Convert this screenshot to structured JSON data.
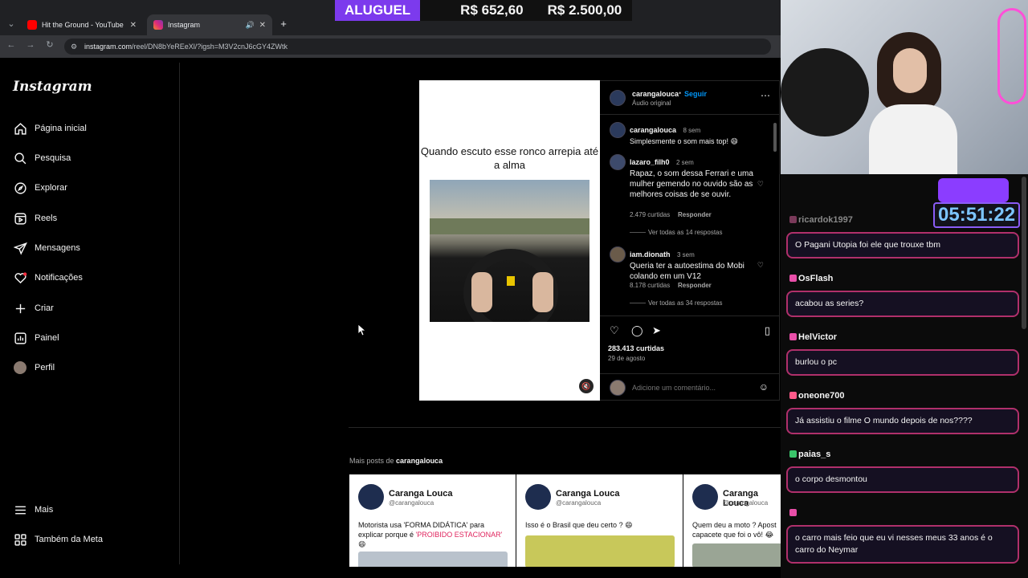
{
  "browser": {
    "tabs": [
      {
        "title": "Hit the Ground - YouTube",
        "active": false
      },
      {
        "title": "Instagram",
        "active": true
      }
    ],
    "url_host": "instagram.com",
    "url_path": "/reel/DN8bYeREeXl/?igsh=M3V2cnJ6cGY4ZWtk"
  },
  "rent_banner": {
    "label": "ALUGUEL",
    "value1": "R$ 652,60",
    "value2": "R$ 2.500,00"
  },
  "instagram": {
    "logo": "Instagram",
    "nav": [
      {
        "label": "Página inicial",
        "icon": "home-icon"
      },
      {
        "label": "Pesquisa",
        "icon": "search-icon"
      },
      {
        "label": "Explorar",
        "icon": "compass-icon"
      },
      {
        "label": "Reels",
        "icon": "reels-icon"
      },
      {
        "label": "Mensagens",
        "icon": "send-icon"
      },
      {
        "label": "Notificações",
        "icon": "heart-icon"
      },
      {
        "label": "Criar",
        "icon": "plus-icon"
      },
      {
        "label": "Painel",
        "icon": "chart-icon"
      },
      {
        "label": "Perfil",
        "icon": "avatar-icon"
      }
    ],
    "bottom_nav": [
      {
        "label": "Mais",
        "icon": "menu-icon"
      },
      {
        "label": "Também da Meta",
        "icon": "meta-icon"
      }
    ],
    "post": {
      "caption": "Quando escuto esse ronco arrepia até a alma",
      "author": "carangalouca",
      "follow": "Seguir",
      "audio": "Áudio original",
      "comments": [
        {
          "user": "carangalouca",
          "time": "8 sem",
          "text": "Simplesmente o som mais top! 😄"
        },
        {
          "user": "lazaro_filh0",
          "time": "2 sem",
          "text": "Rapaz, o som dessa Ferrari e uma mulher gemendo no ouvido são as melhores coisas de se ouvir.",
          "likes": "2.479 curtidas",
          "reply": "Responder",
          "view_replies": "Ver todas as 14 respostas"
        },
        {
          "user": "iam.dionath",
          "time": "3 sem",
          "text": "Queria ter a autoestima do Mobi colando em um V12",
          "likes": "8.178 curtidas",
          "reply": "Responder",
          "view_replies": "Ver todas as 34 respostas"
        }
      ],
      "likes": "283.413 curtidas",
      "date": "29 de agosto",
      "comment_placeholder": "Adicione um comentário..."
    },
    "more_posts": {
      "prefix": "Mais posts de",
      "author": "carangalouca",
      "cards": [
        {
          "name": "Caranga Louca",
          "handle": "@carangalouca",
          "text_a": "Motorista usa 'FORMA DIDÁTICA' para explicar porque é ",
          "text_red": "'PROIBIDO ESTACIONAR'",
          "text_b": " 😄"
        },
        {
          "name": "Caranga Louca",
          "handle": "@carangalouca",
          "text_a": "Isso é o Brasil que deu certo ? 😄",
          "text_red": "",
          "text_b": ""
        },
        {
          "name": "Caranga Louca",
          "handle": "@carangalouca",
          "text_a": "Quem deu a moto ? Apost capacete que foi o vô! 😂",
          "text_red": "",
          "text_b": ""
        }
      ]
    }
  },
  "stream": {
    "timer": "05:51:22",
    "chat": [
      {
        "user": "ricardok1997",
        "message": "O Pagani Utopia foi ele que trouxe tbm"
      },
      {
        "user": "OsFlash",
        "message": "acabou as series?"
      },
      {
        "user": "HelVictor",
        "message": "burlou o pc"
      },
      {
        "user": "oneone700",
        "message": "Já assistiu o filme O mundo depois de nos????"
      },
      {
        "user": "paias_s",
        "message": "o corpo desmontou"
      },
      {
        "user": "",
        "message": "o carro mais feio que eu vi nesses meus 33 anos é o carro do Neymar"
      }
    ]
  }
}
